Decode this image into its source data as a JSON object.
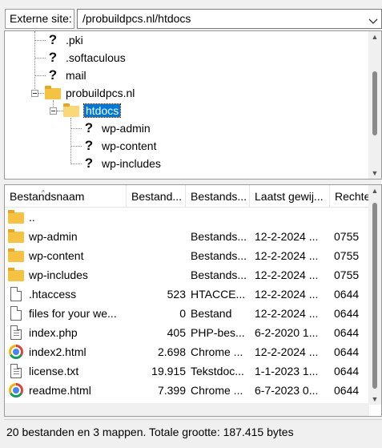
{
  "path_bar": {
    "label": "Externe site:",
    "path": "/probuildpcs.nl/htdocs"
  },
  "tree": {
    "items": [
      {
        "label": ".pki",
        "icon": "unknown-folder-icon"
      },
      {
        "label": ".softaculous",
        "icon": "unknown-folder-icon"
      },
      {
        "label": "mail",
        "icon": "unknown-folder-icon"
      },
      {
        "label": "probuildpcs.nl",
        "icon": "folder-icon",
        "expanded": true
      },
      {
        "label": "htdocs",
        "icon": "folder-open-icon",
        "expanded": true,
        "selected": true
      },
      {
        "label": "wp-admin",
        "icon": "unknown-folder-icon"
      },
      {
        "label": "wp-content",
        "icon": "unknown-folder-icon"
      },
      {
        "label": "wp-includes",
        "icon": "unknown-folder-icon"
      }
    ]
  },
  "list": {
    "columns": [
      "Bestandsnaam",
      "Bestand...",
      "Bestands...",
      "Laatst gewij...",
      "Rechte"
    ],
    "rows": [
      {
        "name": "..",
        "size": "",
        "type": "",
        "modified": "",
        "perms": "",
        "icon": "folder-icon"
      },
      {
        "name": "wp-admin",
        "size": "",
        "type": "Bestands...",
        "modified": "12-2-2024 ...",
        "perms": "0755",
        "icon": "folder-icon"
      },
      {
        "name": "wp-content",
        "size": "",
        "type": "Bestands...",
        "modified": "12-2-2024 ...",
        "perms": "0755",
        "icon": "folder-icon"
      },
      {
        "name": "wp-includes",
        "size": "",
        "type": "Bestands...",
        "modified": "12-2-2024 ...",
        "perms": "0755",
        "icon": "folder-icon"
      },
      {
        "name": ".htaccess",
        "size": "523",
        "type": "HTACCE...",
        "modified": "12-2-2024 ...",
        "perms": "0644",
        "icon": "file-icon"
      },
      {
        "name": "files for your we...",
        "size": "0",
        "type": "Bestand",
        "modified": "12-2-2024 ...",
        "perms": "0644",
        "icon": "file-icon"
      },
      {
        "name": "index.php",
        "size": "405",
        "type": "PHP-bes...",
        "modified": "6-2-2020 1...",
        "perms": "0644",
        "icon": "text-file-icon"
      },
      {
        "name": "index2.html",
        "size": "2.698",
        "type": "Chrome ...",
        "modified": "12-2-2024 ...",
        "perms": "0644",
        "icon": "chrome-icon"
      },
      {
        "name": "license.txt",
        "size": "19.915",
        "type": "Tekstdoc...",
        "modified": "1-1-2023 1...",
        "perms": "0644",
        "icon": "text-file-icon"
      },
      {
        "name": "readme.html",
        "size": "7.399",
        "type": "Chrome ...",
        "modified": "6-7-2023 0...",
        "perms": "0644",
        "icon": "chrome-icon"
      }
    ]
  },
  "status": {
    "text": "20 bestanden en 3 mappen. Totale grootte: 187.415 bytes"
  }
}
